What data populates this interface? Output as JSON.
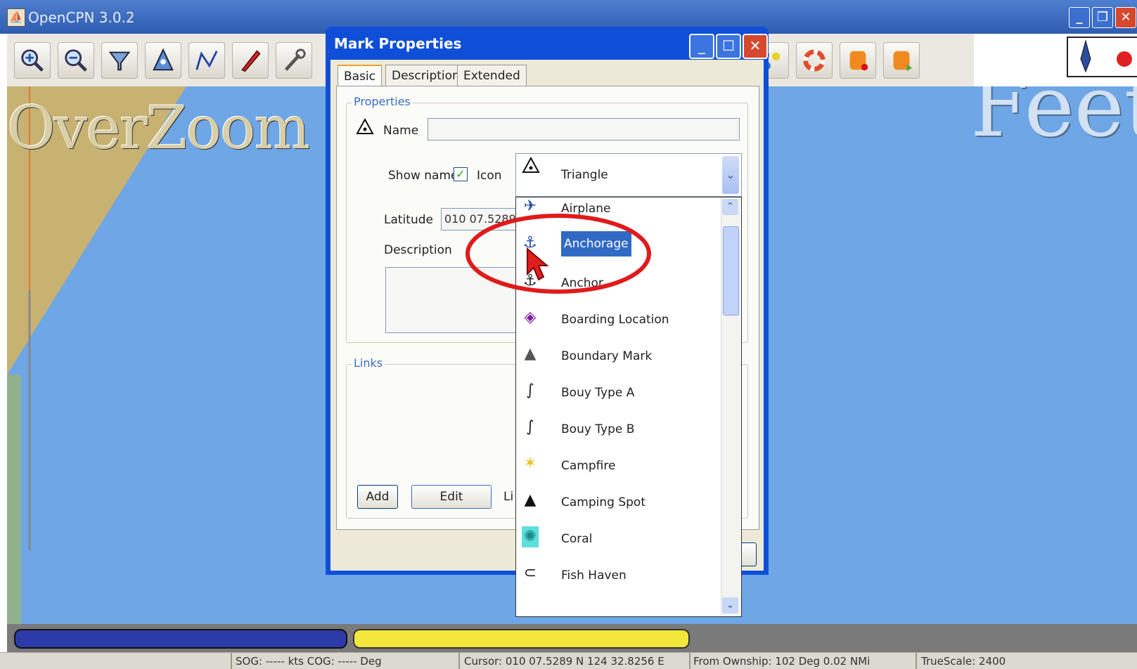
{
  "app": {
    "title": "OpenCPN 3.0.2"
  },
  "chart": {
    "overzoom_text": "OverZoom",
    "feet_text": "Feet"
  },
  "dialog": {
    "title": "Mark Properties",
    "tabs": [
      "Basic",
      "Description",
      "Extended"
    ],
    "properties_label": "Properties",
    "name_label": "Name",
    "name_value": "",
    "show_name_label": "Show name",
    "show_name_checked": true,
    "icon_label": "Icon",
    "icon_selected": "Triangle",
    "latitude_label": "Latitude",
    "latitude_value": "010 07.5289",
    "description_label": "Description",
    "links_label": "Links",
    "add_button": "Add",
    "edit_button": "Edit",
    "links_partial": "Li"
  },
  "icon_list": [
    {
      "label": "Airplane",
      "icon": "airplane-icon"
    },
    {
      "label": "Anchorage",
      "icon": "anchorage-icon",
      "selected": true
    },
    {
      "label": "Anchor",
      "icon": "anchor-icon"
    },
    {
      "label": "Boarding Location",
      "icon": "boarding-location-icon"
    },
    {
      "label": "Boundary Mark",
      "icon": "boundary-mark-icon"
    },
    {
      "label": "Bouy Type A",
      "icon": "bouy-type-a-icon"
    },
    {
      "label": "Bouy Type B",
      "icon": "bouy-type-b-icon"
    },
    {
      "label": "Campfire",
      "icon": "campfire-icon"
    },
    {
      "label": "Camping Spot",
      "icon": "camping-spot-icon"
    },
    {
      "label": "Coral",
      "icon": "coral-icon"
    },
    {
      "label": "Fish Haven",
      "icon": "fish-haven-icon"
    }
  ],
  "status": {
    "sog_cog": "SOG: ----- kts  COG: ----- Deg",
    "cursor": "Cursor: 010 07.5289 N 124 32.8256 E",
    "from_ownship": "From Ownship: 102 Deg    0.02 NMi",
    "truescale": "TrueScale:     2400"
  },
  "colors": {
    "accent": "#0f4fd8",
    "chart_water": "#6ea6e6",
    "land": "#c8b272",
    "highlight_ring": "#e01b1b"
  }
}
